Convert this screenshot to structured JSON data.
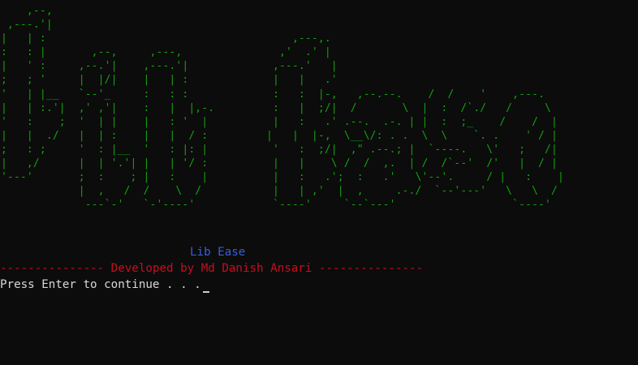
{
  "console": {
    "banner_lines": [
      "    ,--,",
      " ,---.'|",
      "|   | :                                      ,---,.",
      ":   : |       ,--,     ,---,               ,'  .' |",
      "|   ' :     ,--.'|    ,---.'|             ,---.'   |",
      ";   ; '     |  |/|    |   | :             |   |   .'",
      "'   | |__   `--'_     :   : :             :   :  |-,   ,--.--.    /  /    '    ,---.",
      "|   | :.'|  ,' ,'|    :   |  |,-.         :   |  ;/|  /       \\  |  :  /`./   /     \\",
      "'   :    ;  '  | |    |   : '  |          |   :   .' .--.  .-. | |  :  ;_    /    /  |",
      "|   |  ./   |  | :    |   |  / :         |   |  |-,  \\__\\/: . .  \\  \\    `. .    ' / |",
      ";   : ;     '  : |__  '   : |: |          '   :  ;/|  ,\" .--.; |  `----.   \\'   ;   /|",
      "|   ,/      |  | '.'| |   | '/ :          |   |    \\ /  /  ,.  | /  /`--'  /'   |  / |",
      "'---'       ;  :    ; |   :    |          |   :   .';  :   .'   \\'--'.     / |   :    |",
      "            |  ,   /  /    \\  /           |   | ,'  |  ,     .-./  `--'---'   \\   \\  /",
      "             ---`-'   `-'----'            `----'     `--`---'                  `----'"
    ],
    "title": "Lib Ease",
    "credit": "--------------- Developed by Md Danish Ansari ---------------",
    "prompt": "Press Enter to continue . . ."
  }
}
